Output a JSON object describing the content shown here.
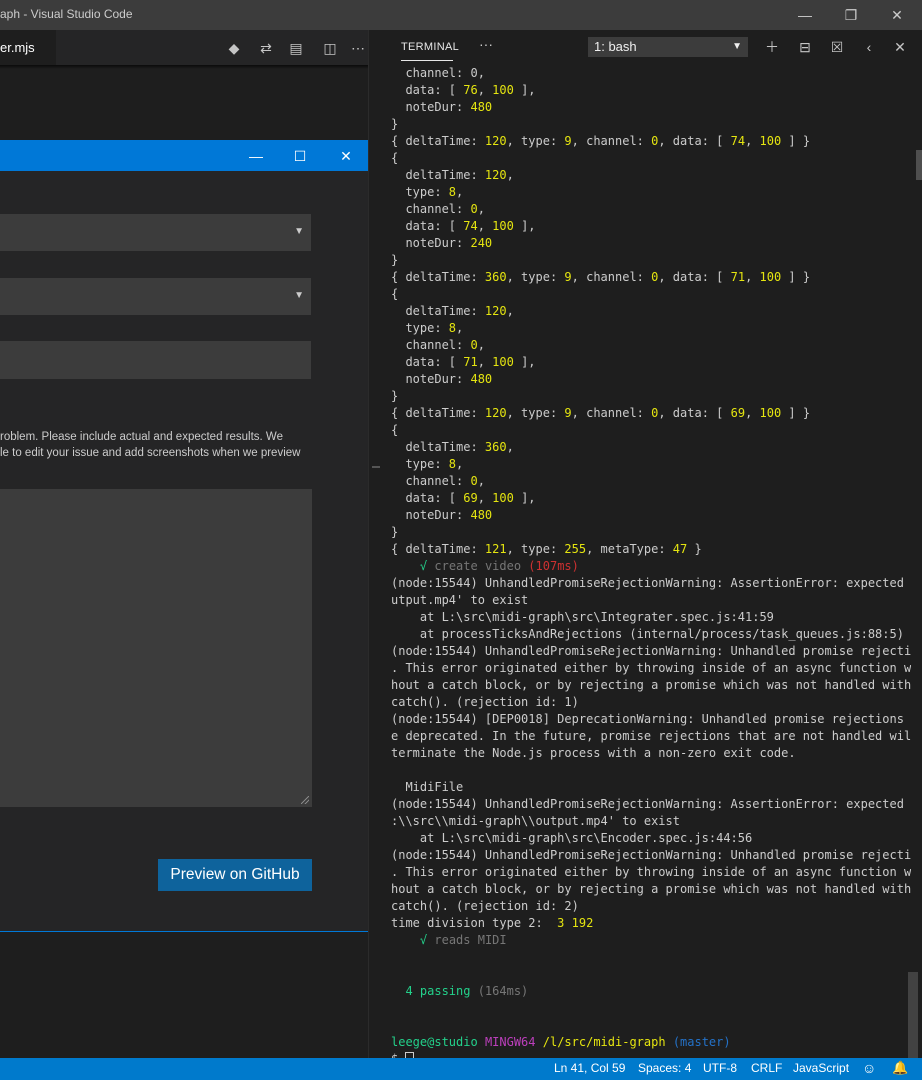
{
  "window": {
    "title": "aph - Visual Studio Code",
    "minimize_icon": "minimize-icon",
    "restore_icon": "restore-icon",
    "close_icon": "close-icon"
  },
  "editor": {
    "tab_label": "er.mjs",
    "toolbar_icons": [
      "git-compare-icon",
      "git-pull-request-icon",
      "preview-icon",
      "split-editor-icon",
      "more-icon"
    ]
  },
  "dialog": {
    "description_line1": "roblem. Please include actual and expected results. We",
    "description_line2": "le to edit your issue and add screenshots when we preview",
    "preview_button": "Preview on GitHub"
  },
  "terminal": {
    "tab_label": "TERMINAL",
    "more_label": "···",
    "shell_select": "1: bash",
    "actions": [
      "add-icon",
      "split-icon",
      "trash-icon",
      "chevron-left-icon",
      "close-icon"
    ],
    "lines": [
      [
        [
          "  channel: 0,",
          ""
        ]
      ],
      [
        [
          "  data: [ ",
          ""
        ],
        [
          "76",
          "y"
        ],
        [
          ", ",
          ""
        ],
        [
          "100",
          "y"
        ],
        [
          " ],",
          ""
        ]
      ],
      [
        [
          "  noteDur: ",
          ""
        ],
        [
          "480",
          "y"
        ]
      ],
      [
        [
          "}",
          ""
        ]
      ],
      [
        [
          "{ deltaTime: ",
          ""
        ],
        [
          "120",
          "y"
        ],
        [
          ", type: ",
          ""
        ],
        [
          "9",
          "y"
        ],
        [
          ", channel: ",
          ""
        ],
        [
          "0",
          "y"
        ],
        [
          ", data: [ ",
          ""
        ],
        [
          "74",
          "y"
        ],
        [
          ", ",
          ""
        ],
        [
          "100",
          "y"
        ],
        [
          " ] }",
          ""
        ]
      ],
      [
        [
          "{",
          ""
        ]
      ],
      [
        [
          "  deltaTime: ",
          ""
        ],
        [
          "120",
          "y"
        ],
        [
          ",",
          ""
        ]
      ],
      [
        [
          "  type: ",
          ""
        ],
        [
          "8",
          "y"
        ],
        [
          ",",
          ""
        ]
      ],
      [
        [
          "  channel: ",
          ""
        ],
        [
          "0",
          "y"
        ],
        [
          ",",
          ""
        ]
      ],
      [
        [
          "  data: [ ",
          ""
        ],
        [
          "74",
          "y"
        ],
        [
          ", ",
          ""
        ],
        [
          "100",
          "y"
        ],
        [
          " ],",
          ""
        ]
      ],
      [
        [
          "  noteDur: ",
          ""
        ],
        [
          "240",
          "y"
        ]
      ],
      [
        [
          "}",
          ""
        ]
      ],
      [
        [
          "{ deltaTime: ",
          ""
        ],
        [
          "360",
          "y"
        ],
        [
          ", type: ",
          ""
        ],
        [
          "9",
          "y"
        ],
        [
          ", channel: ",
          ""
        ],
        [
          "0",
          "y"
        ],
        [
          ", data: [ ",
          ""
        ],
        [
          "71",
          "y"
        ],
        [
          ", ",
          ""
        ],
        [
          "100",
          "y"
        ],
        [
          " ] }",
          ""
        ]
      ],
      [
        [
          "{",
          ""
        ]
      ],
      [
        [
          "  deltaTime: ",
          ""
        ],
        [
          "120",
          "y"
        ],
        [
          ",",
          ""
        ]
      ],
      [
        [
          "  type: ",
          ""
        ],
        [
          "8",
          "y"
        ],
        [
          ",",
          ""
        ]
      ],
      [
        [
          "  channel: ",
          ""
        ],
        [
          "0",
          "y"
        ],
        [
          ",",
          ""
        ]
      ],
      [
        [
          "  data: [ ",
          ""
        ],
        [
          "71",
          "y"
        ],
        [
          ", ",
          ""
        ],
        [
          "100",
          "y"
        ],
        [
          " ],",
          ""
        ]
      ],
      [
        [
          "  noteDur: ",
          ""
        ],
        [
          "480",
          "y"
        ]
      ],
      [
        [
          "}",
          ""
        ]
      ],
      [
        [
          "{ deltaTime: ",
          ""
        ],
        [
          "120",
          "y"
        ],
        [
          ", type: ",
          ""
        ],
        [
          "9",
          "y"
        ],
        [
          ", channel: ",
          ""
        ],
        [
          "0",
          "y"
        ],
        [
          ", data: [ ",
          ""
        ],
        [
          "69",
          "y"
        ],
        [
          ", ",
          ""
        ],
        [
          "100",
          "y"
        ],
        [
          " ] }",
          ""
        ]
      ],
      [
        [
          "{",
          ""
        ]
      ],
      [
        [
          "  deltaTime: ",
          ""
        ],
        [
          "360",
          "y"
        ],
        [
          ",",
          ""
        ]
      ],
      [
        [
          "  type: ",
          ""
        ],
        [
          "8",
          "y"
        ],
        [
          ",",
          ""
        ]
      ],
      [
        [
          "  channel: ",
          ""
        ],
        [
          "0",
          "y"
        ],
        [
          ",",
          ""
        ]
      ],
      [
        [
          "  data: [ ",
          ""
        ],
        [
          "69",
          "y"
        ],
        [
          ", ",
          ""
        ],
        [
          "100",
          "y"
        ],
        [
          " ],",
          ""
        ]
      ],
      [
        [
          "  noteDur: ",
          ""
        ],
        [
          "480",
          "y"
        ]
      ],
      [
        [
          "}",
          ""
        ]
      ],
      [
        [
          "{ deltaTime: ",
          ""
        ],
        [
          "121",
          "y"
        ],
        [
          ", type: ",
          ""
        ],
        [
          "255",
          "y"
        ],
        [
          ", metaType: ",
          ""
        ],
        [
          "47",
          "y"
        ],
        [
          " }",
          ""
        ]
      ],
      [
        [
          "    ",
          ""
        ],
        [
          "√",
          "g"
        ],
        [
          " create video ",
          "gr"
        ],
        [
          "(107ms)",
          "r"
        ]
      ],
      [
        [
          "(node:15544) UnhandledPromiseRejectionWarning: AssertionError: expected 'o",
          ""
        ]
      ],
      [
        [
          "utput.mp4' to exist",
          ""
        ]
      ],
      [
        [
          "    at L:\\src\\midi-graph\\src\\Integrater.spec.js:41:59",
          ""
        ]
      ],
      [
        [
          "    at processTicksAndRejections (internal/process/task_queues.js:88:5)",
          ""
        ]
      ],
      [
        [
          "(node:15544) UnhandledPromiseRejectionWarning: Unhandled promise rejection",
          ""
        ]
      ],
      [
        [
          ". This error originated either by throwing inside of an async function wit",
          ""
        ]
      ],
      [
        [
          "hout a catch block, or by rejecting a promise which was not handled with .",
          ""
        ]
      ],
      [
        [
          "catch(). (rejection id: 1)",
          ""
        ]
      ],
      [
        [
          "(node:15544) [DEP0018] DeprecationWarning: Unhandled promise rejections ar",
          ""
        ]
      ],
      [
        [
          "e deprecated. In the future, promise rejections that are not handled will",
          ""
        ]
      ],
      [
        [
          "terminate the Node.js process with a non-zero exit code.",
          ""
        ]
      ],
      [
        [
          "",
          ""
        ]
      ],
      [
        [
          "  MidiFile",
          ""
        ]
      ],
      [
        [
          "(node:15544) UnhandledPromiseRejectionWarning: AssertionError: expected 'L",
          ""
        ]
      ],
      [
        [
          ":\\\\src\\\\midi-graph\\\\output.mp4' to exist",
          ""
        ]
      ],
      [
        [
          "    at L:\\src\\midi-graph\\src\\Encoder.spec.js:44:56",
          ""
        ]
      ],
      [
        [
          "(node:15544) UnhandledPromiseRejectionWarning: Unhandled promise rejection",
          ""
        ]
      ],
      [
        [
          ". This error originated either by throwing inside of an async function wit",
          ""
        ]
      ],
      [
        [
          "hout a catch block, or by rejecting a promise which was not handled with .",
          ""
        ]
      ],
      [
        [
          "catch(). (rejection id: 2)",
          ""
        ]
      ],
      [
        [
          "time division type 2:  ",
          ""
        ],
        [
          "3",
          "y"
        ],
        [
          " ",
          ""
        ],
        [
          "192",
          "y"
        ]
      ],
      [
        [
          "    ",
          ""
        ],
        [
          "√",
          "g"
        ],
        [
          " reads MIDI",
          "gr"
        ]
      ],
      [
        [
          "",
          ""
        ]
      ],
      [
        [
          "",
          ""
        ]
      ],
      [
        [
          "  ",
          ""
        ],
        [
          "4 passing",
          "g"
        ],
        [
          " (164ms)",
          "gr"
        ]
      ],
      [
        [
          "",
          ""
        ]
      ],
      [
        [
          "",
          ""
        ]
      ],
      [
        [
          "leege@studio",
          "g"
        ],
        [
          " ",
          ""
        ],
        [
          "MINGW64",
          "p"
        ],
        [
          " ",
          ""
        ],
        [
          "/l/src/midi-graph",
          "y"
        ],
        [
          " ",
          ""
        ],
        [
          "(master)",
          "b"
        ]
      ],
      [
        [
          "$ ",
          ""
        ]
      ]
    ]
  },
  "statusbar": {
    "position": "Ln 41, Col 59",
    "spaces": "Spaces: 4",
    "encoding": "UTF-8",
    "eol": "CRLF",
    "language": "JavaScript",
    "feedback_icon": "smiley-icon",
    "notifications_icon": "bell-icon"
  }
}
